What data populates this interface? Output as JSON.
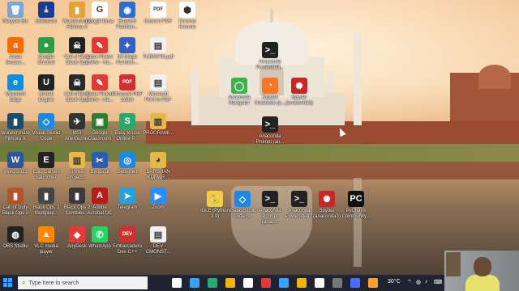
{
  "desktop_icons": [
    {
      "label": "Recycle Bin",
      "color": "#7aa7d6",
      "glyph": "🗑"
    },
    {
      "label": "BitTorrent",
      "color": "#1a3b8f",
      "glyph": "⤓"
    },
    {
      "label": "Wondershare Filmora X",
      "color": "#e3a33a",
      "glyph": "▮"
    },
    {
      "label": "Google Docs",
      "color": "#ffffff",
      "glyph": "G"
    },
    {
      "label": "EaseUS Partition...",
      "color": "#2d6ecf",
      "glyph": "◉"
    },
    {
      "label": "Convert PDF",
      "color": "#ffffff",
      "glyph": "PDF"
    },
    {
      "label": "Chrome Remote",
      "color": "#ffffff",
      "glyph": "⬢"
    },
    {
      "label": "Avast Secure...",
      "color": "#ff6a00",
      "glyph": "a"
    },
    {
      "label": "Google Chrome",
      "color": "#2e9c47",
      "glyph": "●"
    },
    {
      "label": "Call of Duty Black Ops",
      "color": "#222",
      "glyph": "☠"
    },
    {
      "label": "Color Picker online - Ha...",
      "color": "#e53935",
      "glyph": "✎"
    },
    {
      "label": "IM Magic Partition...",
      "color": "#3560c0",
      "glyph": "✦"
    },
    {
      "label": "TURNITIN.pdf",
      "color": "#f0f0f0",
      "glyph": "▤"
    },
    {
      "label": "Microsoft Edge",
      "color": "#0f8fd8",
      "glyph": "e"
    },
    {
      "label": "Unreal Engine",
      "color": "#222",
      "glyph": "U"
    },
    {
      "label": "Call of Duty Black Ops",
      "color": "#2a2a2a",
      "glyph": "☠"
    },
    {
      "label": "Color Picker online - Ha...",
      "color": "#e53935",
      "glyph": "✎"
    },
    {
      "label": "Microsoft PDF Editor",
      "color": "#d32f2f",
      "glyph": "PDF"
    },
    {
      "label": "Microsoft Print to PDF",
      "color": "#f0f0f0",
      "glyph": "▤"
    },
    {
      "label": "Wondershare Filmora X",
      "color": "#1b4c6e",
      "glyph": "▮"
    },
    {
      "label": "Visual Studio Code",
      "color": "#1e88e5",
      "glyph": "◇"
    },
    {
      "label": "MSI Afterburner",
      "color": "#333",
      "glyph": "✈"
    },
    {
      "label": "Google Classroom",
      "color": "#2e7d32",
      "glyph": "▣"
    },
    {
      "label": "Easy to use Online P...",
      "color": "#2aa870",
      "glyph": "S"
    },
    {
      "label": "PROGRAMI...",
      "color": "#e6b84c",
      "glyph": "▥"
    },
    {
      "label": "Word 2013",
      "color": "#2b5797",
      "glyph": "W"
    },
    {
      "label": "Epic Games Launcher",
      "color": "#222",
      "glyph": "E"
    },
    {
      "label": "Unreal Project...",
      "color": "#e6b84c",
      "glyph": "▥"
    },
    {
      "label": "Bandicut",
      "color": "#2a5db0",
      "glyph": "✂"
    },
    {
      "label": "Betternet",
      "color": "#1e88e5",
      "glyph": "◎"
    },
    {
      "label": "DARSHAN KUMAR...",
      "color": "#e6b84c",
      "glyph": "◕"
    },
    {
      "label": "Call of Duty Black Ops 2",
      "color": "#b3542a",
      "glyph": "▮"
    },
    {
      "label": "Black Ops 2 Multiplay...",
      "color": "#444",
      "glyph": "▮"
    },
    {
      "label": "Black Ops 2 Combies...",
      "color": "#3a3a3a",
      "glyph": "▮"
    },
    {
      "label": "Adobe Acrobat DC",
      "color": "#b71c1c",
      "glyph": "A"
    },
    {
      "label": "Telegram",
      "color": "#2aa0da",
      "glyph": "➤"
    },
    {
      "label": "Zoom",
      "color": "#2d8cff",
      "glyph": "▶"
    },
    {
      "label": "OBS Studio",
      "color": "#222",
      "glyph": "◍"
    },
    {
      "label": "VLC media player",
      "color": "#ff8800",
      "glyph": "▲"
    },
    {
      "label": "AnyDesk",
      "color": "#e53935",
      "glyph": "◆"
    },
    {
      "label": "WhatsApp",
      "color": "#25d366",
      "glyph": "✆"
    },
    {
      "label": "Embarcadero Dev-C++",
      "color": "#d32f2f",
      "glyph": "DEV"
    },
    {
      "label": "DEV CMONST...",
      "color": "#f0f0f0",
      "glyph": "▤"
    },
    {
      "label": "Anaconda Powershell...",
      "color": "#222",
      "glyph": ">_"
    },
    {
      "label": "Anaconda Navigator",
      "color": "#3bb54a",
      "glyph": "◯"
    },
    {
      "label": "Jupyter Notebook (a...",
      "color": "#f37726",
      "glyph": "◔"
    },
    {
      "label": "Spyder (anaconda3)",
      "color": "#c62828",
      "glyph": "✺"
    },
    {
      "label": "Anaconda Prompt (an...",
      "color": "#222",
      "glyph": ">_"
    },
    {
      "label": "IDLE (Python 3.9)",
      "color": "#f7c948",
      "glyph": "🐍"
    },
    {
      "label": "Visual Studio Code (...",
      "color": "#1e88e5",
      "glyph": "◇"
    },
    {
      "label": "Anaconda Prompt (anac...",
      "color": "#222",
      "glyph": ">_"
    },
    {
      "label": "Anaconda Powershell...",
      "color": "#222",
      "glyph": ">_"
    },
    {
      "label": "Spyder (anaconda3)",
      "color": "#c62828",
      "glyph": "✺"
    },
    {
      "label": "PyCharm Community...",
      "color": "#111",
      "glyph": "PC"
    }
  ],
  "taskbar": {
    "search_placeholder": "Type here to search",
    "temperature": "30°C",
    "icon_colors": [
      "#ffffff",
      "#3aa0ff",
      "#2aa870",
      "#f5b400",
      "#ffffff",
      "#e53935",
      "#3aa0ff",
      "#f3b400",
      "#ffffff",
      "#777777",
      "#4a6cff",
      "#ff9e2c"
    ]
  }
}
